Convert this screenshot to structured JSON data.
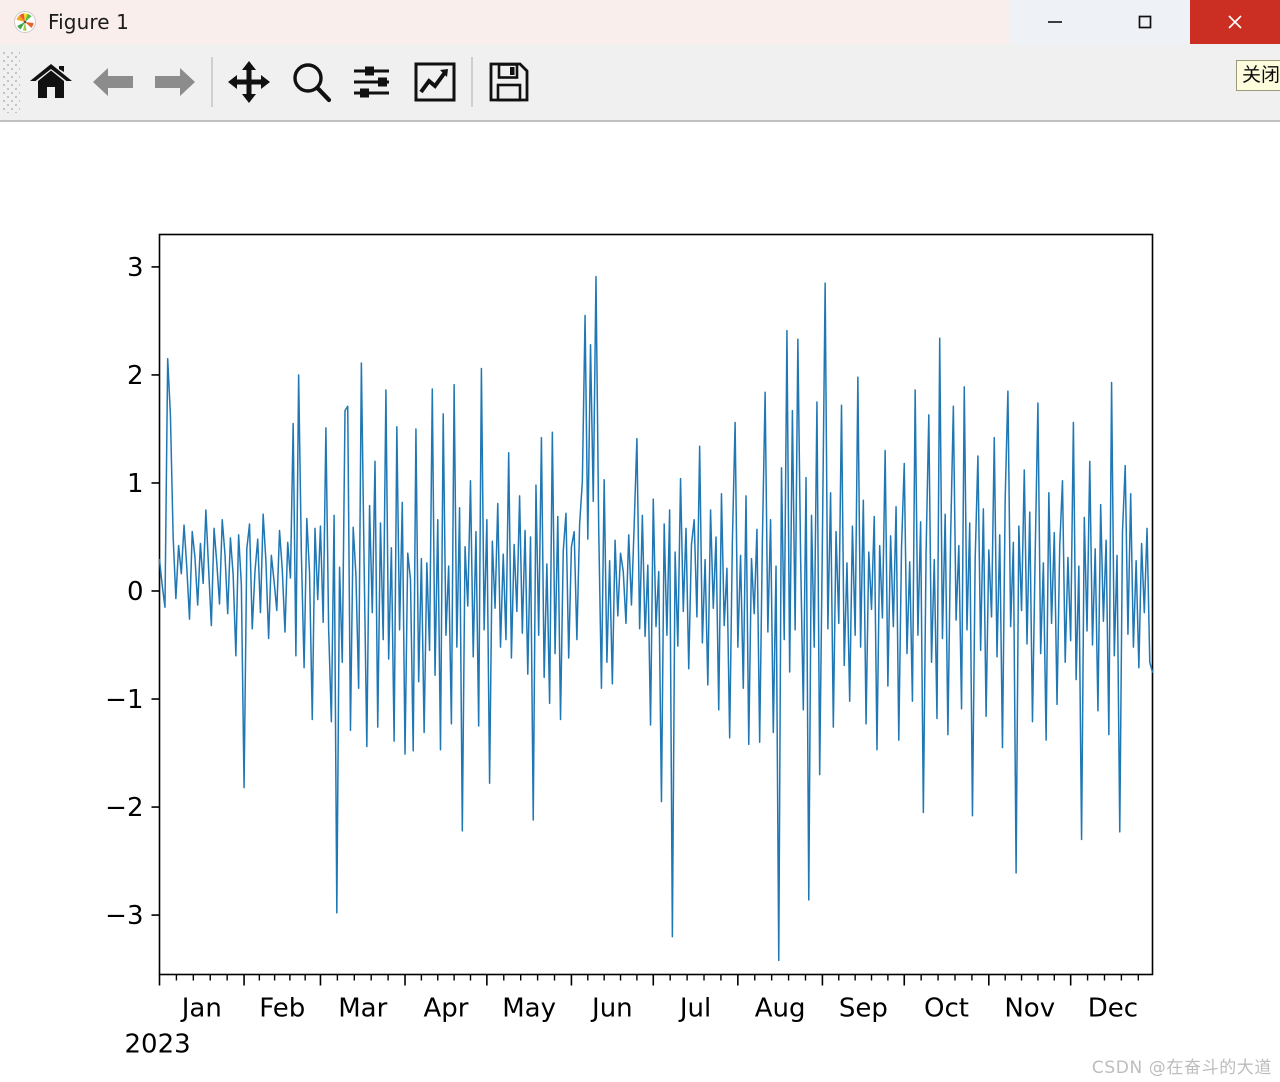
{
  "window": {
    "title": "Figure 1",
    "app_icon": "matplotlib-logo-icon",
    "controls": [
      {
        "name": "minimize",
        "glyph": "minimize-icon"
      },
      {
        "name": "maximize",
        "glyph": "maximize-icon"
      },
      {
        "name": "close",
        "glyph": "close-icon",
        "color": "#cb2e23"
      }
    ]
  },
  "toolbar": {
    "items": [
      {
        "name": "home",
        "icon": "home-icon",
        "enabled": true
      },
      {
        "name": "back",
        "icon": "arrow-left-icon",
        "enabled": false
      },
      {
        "name": "forward",
        "icon": "arrow-right-icon",
        "enabled": false
      },
      {
        "name": "separator-1",
        "icon": "separator",
        "enabled": false
      },
      {
        "name": "pan",
        "icon": "move-icon",
        "enabled": true
      },
      {
        "name": "zoom",
        "icon": "magnifier-icon",
        "enabled": true
      },
      {
        "name": "subplots",
        "icon": "sliders-icon",
        "enabled": true
      },
      {
        "name": "customize",
        "icon": "chart-line-icon",
        "enabled": true
      },
      {
        "name": "separator-2",
        "icon": "separator",
        "enabled": false
      },
      {
        "name": "save",
        "icon": "floppy-disk-icon",
        "enabled": true
      }
    ]
  },
  "tooltip": {
    "text": "关闭",
    "background": "#fdfcdc"
  },
  "watermark": {
    "text": "CSDN @在奋斗的大道"
  },
  "chart_data": {
    "type": "line",
    "title": "",
    "xlabel": "",
    "ylabel": "",
    "year_label": "2023",
    "line_color": "#1f77b4",
    "line_width": 1.5,
    "grid": false,
    "legend": null,
    "ylim": [
      -3.55,
      3.3
    ],
    "yticks": [
      3,
      2,
      1,
      0,
      -1,
      -2,
      -3
    ],
    "ytick_labels": [
      "3",
      "2",
      "1",
      "0",
      "−1",
      "−2",
      "−3"
    ],
    "xlim": [
      "2023-01-01",
      "2023-12-31"
    ],
    "xtick_labels": [
      "Jan",
      "Feb",
      "Mar",
      "Apr",
      "May",
      "Jun",
      "Jul",
      "Aug",
      "Sep",
      "Oct",
      "Nov",
      "Dec"
    ],
    "x_minor_ticks_per_month": 4,
    "x_description": "daily samples over calendar year 2023 (365 points)",
    "summary": {
      "n_points": 365,
      "min": -3.42,
      "max": 2.93,
      "mean": 0.0,
      "std": 1.0
    },
    "values": [
      0.29,
      0.05,
      -0.15,
      2.15,
      1.63,
      0.5,
      -0.07,
      0.42,
      0.16,
      0.61,
      0.22,
      -0.26,
      0.55,
      0.31,
      -0.13,
      0.44,
      0.07,
      0.75,
      0.21,
      -0.32,
      0.58,
      0.26,
      -0.12,
      0.66,
      0.34,
      -0.21,
      0.49,
      0.15,
      -0.6,
      0.52,
      0.06,
      -1.82,
      0.39,
      0.62,
      -0.35,
      0.18,
      0.48,
      -0.2,
      0.71,
      0.28,
      -0.44,
      0.33,
      0.09,
      -0.18,
      0.56,
      0.2,
      -0.38,
      0.45,
      0.12,
      1.55,
      -0.6,
      2.0,
      0.35,
      -0.71,
      0.67,
      0.17,
      -1.19,
      0.58,
      -0.08,
      0.6,
      -0.29,
      1.51,
      -0.35,
      -1.21,
      0.7,
      -2.98,
      0.22,
      -0.66,
      1.67,
      1.71,
      -1.29,
      0.59,
      0.15,
      -0.9,
      2.11,
      0.26,
      -1.44,
      0.79,
      -0.2,
      1.2,
      -1.26,
      0.63,
      -0.45,
      1.86,
      -0.63,
      0.4,
      -1.39,
      1.52,
      -0.36,
      0.82,
      -1.51,
      0.35,
      0.11,
      -1.48,
      1.5,
      -0.84,
      0.3,
      -1.31,
      0.26,
      -0.55,
      1.87,
      -0.78,
      0.66,
      -1.47,
      1.64,
      -0.41,
      0.23,
      -1.23,
      1.91,
      -0.52,
      0.77,
      -2.22,
      0.41,
      -0.14,
      1.02,
      -0.61,
      0.55,
      -1.25,
      2.06,
      -0.36,
      0.66,
      -1.78,
      0.46,
      -0.16,
      0.81,
      -0.52,
      0.34,
      -0.45,
      1.28,
      -0.62,
      0.43,
      -0.19,
      0.88,
      -0.39,
      0.56,
      -0.77,
      0.5,
      -2.12,
      0.98,
      -0.41,
      1.42,
      -0.8,
      0.25,
      -1.04,
      1.47,
      -0.58,
      0.69,
      -1.19,
      0.37,
      0.72,
      -0.62,
      0.41,
      0.55,
      -0.45,
      0.62,
      1.01,
      2.55,
      0.48,
      2.28,
      0.83,
      2.91,
      0.58,
      -0.9,
      1.03,
      -0.66,
      0.28,
      -0.86,
      0.47,
      -0.23,
      0.35,
      0.18,
      -0.3,
      0.52,
      -0.13,
      0.61,
      1.41,
      -0.35,
      0.7,
      -0.42,
      0.24,
      -1.24,
      0.85,
      -0.33,
      0.18,
      -1.95,
      0.62,
      -0.41,
      0.75,
      -3.2,
      0.36,
      -0.51,
      1.04,
      -0.19,
      0.58,
      -0.72,
      0.43,
      0.66,
      -0.24,
      1.34,
      -0.48,
      0.29,
      -0.87,
      0.75,
      -0.16,
      0.5,
      -1.1,
      0.9,
      -0.32,
      0.21,
      -1.36,
      0.46,
      1.56,
      -0.52,
      0.33,
      -0.9,
      0.88,
      -1.42,
      0.3,
      -0.21,
      0.57,
      -1.4,
      0.47,
      1.84,
      -0.38,
      0.66,
      -1.31,
      0.23,
      -3.42,
      1.14,
      -0.45,
      2.41,
      -0.75,
      1.67,
      -0.36,
      2.33,
      0.32,
      -1.1,
      1.05,
      -2.86,
      0.7,
      -0.52,
      1.75,
      -1.7,
      0.48,
      2.85,
      -0.35,
      0.91,
      -1.26,
      0.55,
      -0.3,
      1.72,
      -0.69,
      0.26,
      -1.02,
      0.6,
      -0.41,
      1.98,
      -0.52,
      0.84,
      -1.23,
      0.36,
      -0.17,
      0.69,
      -1.47,
      0.42,
      -0.25,
      1.3,
      -0.88,
      0.51,
      -0.33,
      0.78,
      -1.38,
      0.4,
      1.18,
      -0.58,
      0.27,
      -1.02,
      1.86,
      -0.41,
      0.64,
      -2.05,
      0.35,
      1.63,
      -0.66,
      0.29,
      -1.18,
      2.34,
      -0.44,
      0.71,
      -1.33,
      0.5,
      1.71,
      -0.27,
      0.42,
      -1.09,
      1.89,
      -0.36,
      0.63,
      -2.08,
      0.3,
      1.25,
      -0.55,
      0.76,
      -1.16,
      0.38,
      -0.24,
      1.42,
      -0.61,
      0.52,
      -1.45,
      0.86,
      1.85,
      -0.33,
      0.45,
      -2.61,
      0.6,
      -0.18,
      1.12,
      -0.49,
      0.73,
      -1.21,
      0.35,
      1.74,
      -0.58,
      0.26,
      -1.38,
      0.91,
      -0.3,
      0.54,
      -1.05,
      0.42,
      1.02,
      -0.66,
      0.31,
      -0.46,
      1.56,
      -0.82,
      0.23,
      -2.3,
      0.68,
      -0.37,
      1.2,
      -0.5,
      0.39,
      -1.11,
      0.8,
      -0.28,
      0.47,
      -1.33,
      1.93,
      -0.6,
      0.33,
      -2.23,
      0.55,
      1.16,
      -0.4,
      0.9,
      -0.52,
      0.28,
      -0.71,
      0.44,
      -0.2,
      0.58,
      -0.66,
      -0.75
    ]
  }
}
